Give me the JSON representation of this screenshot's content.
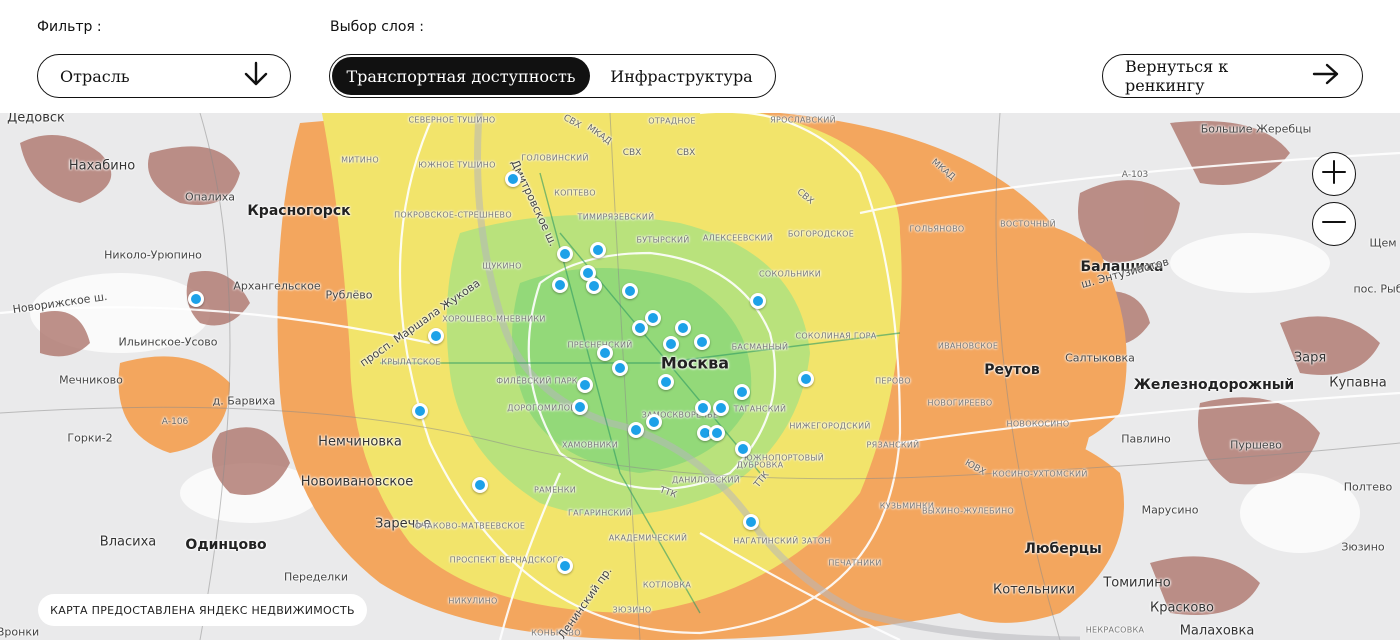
{
  "filter": {
    "caption": "Фильтр :",
    "selected": "Отрасль",
    "icon": "arrow-down-icon"
  },
  "layer": {
    "caption": "Выбор слоя :",
    "options": [
      "Транспортная доступность",
      "Инфраструктура"
    ],
    "active": "Транспортная доступность"
  },
  "back_button": {
    "label": "Вернуться к ренкингу",
    "icon": "arrow-right-icon"
  },
  "zoom": {
    "in_icon": "plus-icon",
    "out_icon": "minus-icon"
  },
  "attribution": "КАРТА ПРЕДОСТАВЛЕНА ЯНДЕКС НЕДВИЖИМОСТЬ",
  "colors": {
    "accent": "#111111",
    "marker": "#1da1e8",
    "heat_high": "#9bdc7d",
    "heat_mid": "#f2e56a",
    "heat_low": "#f3a35c",
    "heat_min": "#a8766c"
  },
  "map": {
    "cities": {
      "moscow": "Москва",
      "krasnogorsk": "Красногорск",
      "balashikha": "Балашиха",
      "reutov": "Реутов",
      "zheleznodorozhny": "Железнодорожный",
      "lyubertsy": "Люберцы",
      "odintsovo": "Одинцово",
      "nakhabino": "Нахабино",
      "nemchinovka": "Немчиновка",
      "zarechye": "Заречье",
      "novoivanovskoe": "Новоивановское",
      "kotelniki": "Котельники",
      "kupavna": "Купавна",
      "zarya": "Заря",
      "tomilino": "Томилино",
      "kraskovo": "Красково",
      "malakhovka": "Малаховка",
      "vlasikha": "Власиха",
      "dedovsk": "Дедовск"
    },
    "towns": {
      "opalikha": "Опалиха",
      "nikolo_uryupino": "Николо-Урюпино",
      "arkhangelskoe": "Архангельское",
      "rublevo": "Рублёво",
      "ilinskoe_usovo": "Ильинское-Усово",
      "mechnikovo": "Мечниково",
      "d_barvikha": "д. Барвиха",
      "gorki_2": "Горки-2",
      "peredelki": "Переделки",
      "saltykovka": "Салтыковка",
      "pavlino": "Павлино",
      "purshevo": "Пуршево",
      "marusino": "Марусино",
      "bolshie_zherebtsy": "Большие Жеребцы",
      "pos_ryazhsk": "пос. Рыб",
      "ozerki": "Щем",
      "vronki": "Вронки",
      "zyuzino": "Зюзино",
      "poltevo": "Полтево"
    },
    "districts": {
      "severnoe_tushino": "СЕВЕРНОЕ ТУШИНО",
      "mitino": "МИТИНО",
      "yuzhnoe_tushino": "ЮЖНОЕ ТУШИНО",
      "golovinsky": "ГОЛОВИНСКИЙ",
      "koptevo": "КОПТЕВО",
      "timiryazevsky": "ТИМИРЯЗЕВСКИЙ",
      "butyrsky": "БУТЫРСКИЙ",
      "alekseevsky": "АЛЕКСЕЕВСКИЙ",
      "otradnoe": "ОТРАДНОЕ",
      "yaroslavsky": "ЯРОСЛАВСКИЙ",
      "sokolniki": "СОКОЛЬНИКИ",
      "bogorodskoe": "БОГОРОДСКОЕ",
      "golyanovo": "ГОЛЬЯНОВО",
      "vostochny": "ВОСТОЧНЫЙ",
      "pokrovskoe_streshnevo": "ПОКРОВСКОЕ-СТРЕШНЕВО",
      "shchukino": "ЩУКИНО",
      "khoroshevo_mnevniki": "ХОРОШЕВО-МНЕВНИКИ",
      "krylatskoe": "КРЫЛАТСКОЕ",
      "filevsky_park": "ФИЛЁВСКИЙ ПАРК",
      "dorogomilovo": "ДОРОГОМИЛОВО",
      "ramenki": "РАМЕНКИ",
      "ochakovo": "ОЧАКОВО-МАТВЕЕВСКОЕ",
      "prospekt_vernadskogo": "ПРОСПЕКТ ВЕРНАДСКОГО",
      "nikulino": "НИКУЛИНО",
      "akademichesky": "АКАДЕМИЧЕСКИЙ",
      "gagarinsky": "ГАГАРИНСКИЙ",
      "kotlovka": "КОТЛОВКА",
      "zyuzino_d": "ЗЮЗИНО",
      "konkovo": "КОНЬКОВО",
      "danilovsky": "ДАНИЛОВСКИЙ",
      "nagatinsky_zaton": "НАГАТИНСКИЙ ЗАТОН",
      "tagansky": "ТАГАНСКИЙ",
      "basmanny": "БАСМАННЫЙ",
      "sokolinaya_gora": "СОКОЛИНАЯ ГОРА",
      "ivanovskoe": "ИВАНОВСКОЕ",
      "perovo": "ПЕРОВО",
      "ryazansky": "РЯЗАНСКИЙ",
      "nizhegorodsky": "НИЖЕГОРОДСКИЙ",
      "kuzminki": "КУЗЬМИНКИ",
      "vykhino": "ВЫХИНО-ЖУЛЕБИНО",
      "novokosino": "НОВОКОСИНО",
      "nekrasovka": "НЕКРАСОВКА",
      "kosino": "КОСИНО-УХТОМСКИЙ",
      "dubrovka": "ДУБРОВКА",
      "pechatniki": "ПЕЧАТНИКИ",
      "yuzhnoportovy": "ЮЖНОПОРТОВЫЙ",
      "novogireevo": "НОВОГИРЕЕВО",
      "presnensky": "ПРЕСНЕНСКИЙ",
      "khamovniki": "ХАМОВНИКИ",
      "zamoskvorechye": "ЗАМОСКВОРЕЧЬЕ"
    },
    "roads": {
      "mkad_1": "МКАД",
      "mkad_2": "МКАД",
      "ttk_1": "ТТК",
      "ttk_2": "ТТК",
      "svkh_1": "СВХ",
      "svkh_2": "СВХ",
      "svkh_3": "СВХ",
      "svkh_4": "СВХ",
      "a103": "А-103",
      "a106": "А-106",
      "novorizhskoe": "Новорижское ш.",
      "entuziastov": "ш. Энтузиастов",
      "marshala_zhukova": "просп. Маршала Жукова",
      "leninsky": "Ленинский пр.",
      "dmitrovskoe": "Дмитровское ш.",
      "yuv": "ЮВХ"
    }
  }
}
